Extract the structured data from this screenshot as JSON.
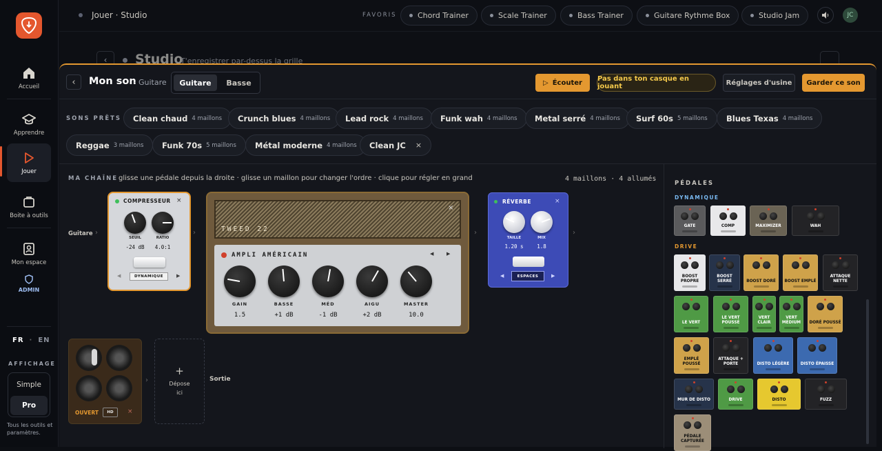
{
  "app": {
    "admin_label": "ADMIN",
    "lang_fr": "FR",
    "lang_en": "EN",
    "lang_sep": "·",
    "display_label": "AFFICHAGE",
    "mode_simple": "Simple",
    "mode_pro": "Pro",
    "mode_hint": "Tous les outils et paramètres."
  },
  "nav": [
    {
      "label": "Accueil",
      "icon": "home-icon"
    },
    {
      "label": "Apprendre",
      "icon": "graduation-cap-icon"
    },
    {
      "label": "Jouer",
      "icon": "play-icon"
    },
    {
      "label": "Boite à outils",
      "icon": "toolbox-icon"
    },
    {
      "label": "Mon espace",
      "icon": "profile-icon"
    }
  ],
  "topbar": {
    "breadcrumb": "Jouer · Studio",
    "favorites_label": "FAVORIS",
    "favorites": [
      "Chord Trainer",
      "Scale Trainer",
      "Bass Trainer",
      "Guitare Rythme Box",
      "Studio Jam"
    ],
    "avatar": "JC"
  },
  "background": {
    "title": "Studio",
    "subtitle": "T'enregistrer par-dessus la grille"
  },
  "panel": {
    "title": "Mon son",
    "subtitle": "· Guitare",
    "tabs": [
      "Guitare",
      "Basse"
    ],
    "active_tab": "Guitare",
    "listen": "Écouter",
    "headphones_hint": "Pas dans ton casque en jouant",
    "factory": "Réglages d'usine",
    "keep": "Garder ce son"
  },
  "presets": {
    "label": "SONS PRÊTS",
    "items": [
      {
        "name": "Clean chaud",
        "count": "4 maillons"
      },
      {
        "name": "Crunch blues",
        "count": "4 maillons"
      },
      {
        "name": "Lead rock",
        "count": "4 maillons"
      },
      {
        "name": "Funk wah",
        "count": "4 maillons"
      },
      {
        "name": "Metal serré",
        "count": "4 maillons"
      },
      {
        "name": "Surf 60s",
        "count": "5 maillons"
      },
      {
        "name": "Blues Texas",
        "count": "4 maillons"
      },
      {
        "name": "Reggae",
        "count": "3 maillons"
      },
      {
        "name": "Funk 70s",
        "count": "5 maillons"
      },
      {
        "name": "Métal moderne",
        "count": "4 maillons"
      },
      {
        "name": "Clean JC",
        "count": "",
        "closable": true
      }
    ]
  },
  "chain": {
    "label": "MA CHAÎNE",
    "hint": "glisse une pédale depuis la droite · glisse un maillon pour changer l'ordre · clique pour régler en grand",
    "status": "4 maillons · 4 allumés",
    "input_label": "Guitare",
    "output_label": "Sortie",
    "drop_label": "Dépose ici",
    "compressor": {
      "name": "COMPRESSEUR",
      "knobs": [
        {
          "label": "SEUIL",
          "value": "-24 dB"
        },
        {
          "label": "RATIO",
          "value": "4.0:1"
        }
      ],
      "mode": "DYNAMIQUE"
    },
    "amp": {
      "brand": "TWEED 22",
      "name": "AMPLI AMÉRICAIN",
      "knobs": [
        {
          "label": "GAIN",
          "value": "1.5"
        },
        {
          "label": "BASSE",
          "value": "+1 dB"
        },
        {
          "label": "MÉD",
          "value": "-1 dB"
        },
        {
          "label": "AIGU",
          "value": "+2 dB"
        },
        {
          "label": "MASTER",
          "value": "10.0"
        }
      ]
    },
    "reverb": {
      "name": "RÉVERBE",
      "knobs": [
        {
          "label": "TAILLE",
          "value": "1.20 s"
        },
        {
          "label": "MIX",
          "value": "1.8"
        }
      ],
      "mode": "ESPACES"
    },
    "cab": {
      "label": "OUVERT",
      "badge": "HD"
    }
  },
  "pedals": {
    "label": "PÉDALES",
    "categories": [
      {
        "name": "DYNAMIQUE",
        "items": [
          "GATE",
          "COMP",
          "MAXIMIZER",
          "WAH"
        ]
      },
      {
        "name": "DRIVE",
        "items": [
          "BOOST PROPRE",
          "BOOST SERRÉ",
          "BOOST DORÉ",
          "BOOST EMPLÉ",
          "ATTAQUE NETTE",
          "LE VERT",
          "LE VERT POUSSÉ",
          "VERT CLAIR",
          "VERT MÉDIUM",
          "DORÉ POUSSÉ",
          "EMPLÉ POUSSÉ",
          "ATTAQUE + PORTE",
          "DISTO LÉGÈRE",
          "DISTO ÉPAISSE",
          "MUR DE DISTO",
          "DRIVE",
          "DISTO",
          "FUZZ",
          "PÉDALE CAPTURÉE"
        ]
      }
    ]
  },
  "colors": {
    "accent": "#e4572e",
    "panel_border": "#e49830",
    "amber": "#e49830",
    "yellow": "#f3c84b"
  }
}
